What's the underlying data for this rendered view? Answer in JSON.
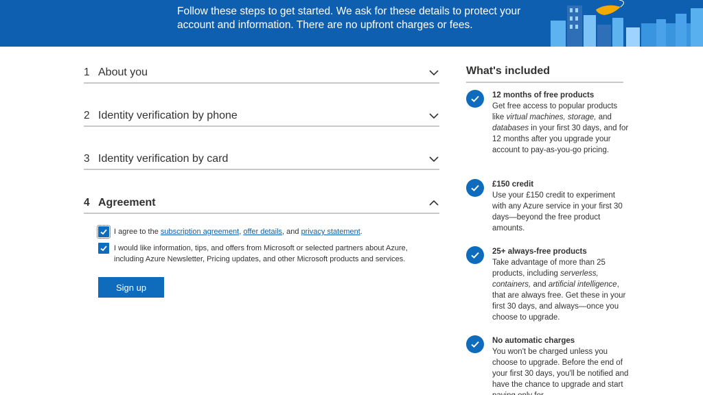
{
  "banner": {
    "subtitle": "Follow these steps to get started. We ask for these details to protect your account and information. There are no upfront charges or fees."
  },
  "steps": [
    {
      "number": "1",
      "title": "About you",
      "icon": "chevron-down-icon"
    },
    {
      "number": "2",
      "title": "Identity verification by phone",
      "icon": "chevron-down-icon"
    },
    {
      "number": "3",
      "title": "Identity verification by card",
      "icon": "chevron-down-icon"
    },
    {
      "number": "4",
      "title": "Agreement",
      "icon": "chevron-up-icon"
    }
  ],
  "agreement": {
    "check1_prefix": "I agree to the ",
    "check1_link1": "subscription agreement",
    "check1_sep1": ", ",
    "check1_link2": "offer details",
    "check1_sep2": ", and ",
    "check1_link3": "privacy statement",
    "check1_suffix": ".",
    "check1_checked": true,
    "check2_text": "I would like information, tips, and offers from Microsoft or selected partners about Azure, including Azure Newsletter, Pricing updates, and other Microsoft products and services.",
    "check2_checked": true,
    "signup_label": "Sign up"
  },
  "included": {
    "title": "What's included",
    "items": [
      {
        "heading": "12 months of free products",
        "text_parts": [
          "Get free access to popular products like ",
          "virtual machines, storage,",
          " and ",
          "databases",
          " in your first 30 days, and for 12 months after you upgrade your account to pay-as-you-go pricing."
        ]
      },
      {
        "heading": "£150 credit",
        "text": "Use your £150 credit to experiment with any Azure service in your first 30 days—beyond the free product amounts."
      },
      {
        "heading": "25+ always-free products",
        "text_parts": [
          "Take advantage of more than 25 products, including ",
          "serverless, containers,",
          " and ",
          "artificial intelligence",
          ", that are always free. Get these in your first 30 days, and always—once you choose to upgrade."
        ]
      },
      {
        "heading": "No automatic charges",
        "text": "You won't be charged unless you choose to upgrade. Before the end of your first 30 days, you'll be notified and have the chance to upgrade and start paying only for"
      }
    ]
  },
  "colors": {
    "brand_blue": "#0f6cbd",
    "banner_blue": "#0f5fb0"
  }
}
